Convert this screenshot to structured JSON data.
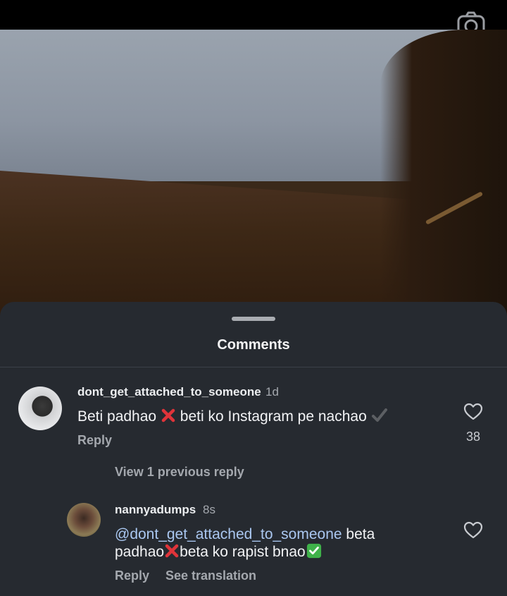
{
  "header": {
    "camera_icon": "camera-icon"
  },
  "sheet": {
    "title": "Comments"
  },
  "comments": [
    {
      "username": "dont_get_attached_to_someone",
      "time": "1d",
      "text_before": "Beti padhao ",
      "emoji1": "cross-mark",
      "text_middle": " beti ko Instagram pe nachao ",
      "emoji2": "check-mark",
      "reply_label": "Reply",
      "like_count": "38"
    }
  ],
  "view_replies": "View 1 previous reply",
  "reply": {
    "username": "nannyadumps",
    "time": "8s",
    "mention": "@dont_get_attached_to_someone",
    "text_line1": " beta",
    "text_line2a": "padhao",
    "text_line2b": "beta ko rapist bnao",
    "reply_label": "Reply",
    "see_translation": "See translation"
  },
  "colors": {
    "sheet_bg": "#262a30",
    "mention": "#aac7f0",
    "muted": "#a4a8ae"
  }
}
